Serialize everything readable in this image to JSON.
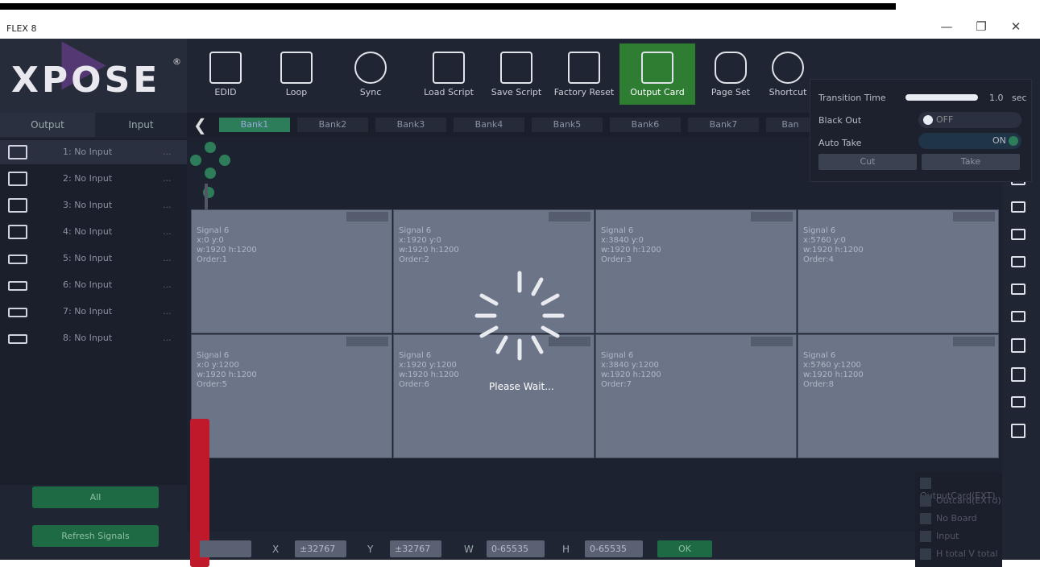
{
  "window": {
    "title": "FLEX 8",
    "controls": [
      "—",
      "❐",
      "✕"
    ]
  },
  "logo": {
    "text": "XPOSE",
    "reg": "®"
  },
  "toolbar": {
    "items": [
      {
        "label": "EDID",
        "icon": "edid-icon"
      },
      {
        "label": "Loop",
        "icon": "loop-icon"
      },
      {
        "label": "Sync",
        "icon": "sync-icon"
      },
      {
        "label": "Load Script",
        "icon": "load-script-icon"
      },
      {
        "label": "Save Script",
        "icon": "save-script-icon"
      },
      {
        "label": "Factory Reset",
        "icon": "factory-reset-icon"
      },
      {
        "label": "Output Card",
        "icon": "output-card-icon",
        "active": true
      },
      {
        "label": "Page Set",
        "icon": "page-set-icon"
      },
      {
        "label": "Shortcut",
        "icon": "shortcut-icon"
      }
    ]
  },
  "left_tabs": {
    "output": "Output",
    "input": "Input"
  },
  "banks": [
    "Bank1",
    "Bank2",
    "Bank3",
    "Bank4",
    "Bank5",
    "Bank6",
    "Bank7",
    "Ban"
  ],
  "inputs": [
    "1: No Input",
    "2: No Input",
    "3: No Input",
    "4: No Input",
    "5: No Input",
    "6: No Input",
    "7: No Input",
    "8: No Input"
  ],
  "input_dots": "...",
  "left_buttons": {
    "all": "All",
    "refresh": "Refresh Signals"
  },
  "cells": [
    {
      "signal": "Signal 6",
      "pos": "x:0  y:0",
      "size": "w:1920  h:1200",
      "order": "Order:1"
    },
    {
      "signal": "Signal 6",
      "pos": "x:1920  y:0",
      "size": "w:1920  h:1200",
      "order": "Order:2"
    },
    {
      "signal": "Signal 6",
      "pos": "x:3840  y:0",
      "size": "w:1920  h:1200",
      "order": "Order:3"
    },
    {
      "signal": "Signal 6",
      "pos": "x:5760  y:0",
      "size": "w:1920  h:1200",
      "order": "Order:4"
    },
    {
      "signal": "Signal 6",
      "pos": "x:0  y:1200",
      "size": "w:1920  h:1200",
      "order": "Order:5"
    },
    {
      "signal": "Signal 6",
      "pos": "x:1920  y:1200",
      "size": "w:1920  h:1200",
      "order": "Order:6"
    },
    {
      "signal": "Signal 6",
      "pos": "x:3840  y:1200",
      "size": "w:1920  h:1200",
      "order": "Order:7"
    },
    {
      "signal": "Signal 6",
      "pos": "x:5760  y:1200",
      "size": "w:1920  h:1200",
      "order": "Order:8"
    }
  ],
  "spinner": {
    "text": "Please Wait..."
  },
  "legend": [
    "OutputCard(EXT)",
    "Outcard(EXTd)",
    "No Board",
    "Input",
    "H total V total"
  ],
  "bottom": {
    "x_label": "X",
    "x_ph": "±32767",
    "y_label": "Y",
    "y_ph": "±32767",
    "w_label": "W",
    "w_ph": "0-65535",
    "h_label": "H",
    "h_ph": "0-65535",
    "ok": "OK"
  },
  "popup": {
    "transition_label": "Transition Time",
    "transition_value": "1.0",
    "transition_unit": "sec",
    "blackout_label": "Black Out",
    "blackout_state": "OFF",
    "autotake_label": "Auto Take",
    "autotake_state": "ON",
    "cut": "Cut",
    "take": "Take"
  },
  "colors": {
    "accent": "#2e7d32",
    "bg": "#1f2533",
    "cell": "#6c7488",
    "red": "#c0192c"
  }
}
